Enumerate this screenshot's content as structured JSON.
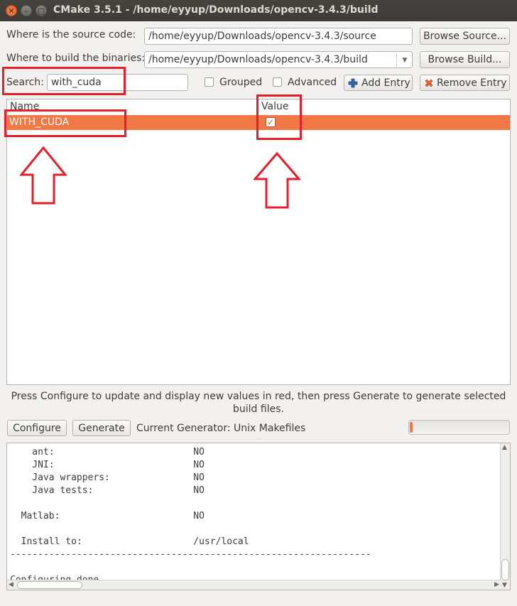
{
  "window": {
    "title": "CMake 3.5.1 - /home/eyyup/Downloads/opencv-3.4.3/build",
    "close_glyph": "✕",
    "min_glyph": "–",
    "max_glyph": "□"
  },
  "source": {
    "label": "Where is the source code:",
    "value": "/home/eyyup/Downloads/opencv-3.4.3/source",
    "browse_label": "Browse Source..."
  },
  "build": {
    "label": "Where to build the binaries:",
    "value": "/home/eyyup/Downloads/opencv-3.4.3/build",
    "browse_label": "Browse Build..."
  },
  "search": {
    "label": "Search:",
    "value": "with_cuda",
    "grouped_label": "Grouped",
    "grouped_checked": false,
    "advanced_label": "Advanced",
    "advanced_checked": false,
    "add_entry_label": "Add Entry",
    "remove_entry_label": "Remove Entry"
  },
  "table": {
    "columns": [
      "Name",
      "Value"
    ],
    "rows": [
      {
        "name": "WITH_CUDA",
        "value_checked": true,
        "check_glyph": "✓"
      }
    ]
  },
  "description": "Press Configure to update and display new values in red, then press Generate to generate selected build files.",
  "actions": {
    "configure_label": "Configure",
    "generate_label": "Generate",
    "generator_text": "Current Generator: Unix Makefiles",
    "progress": 0.02
  },
  "output": {
    "text": "    ant:                         NO\n    JNI:                         NO\n    Java wrappers:               NO\n    Java tests:                  NO\n\n  Matlab:                        NO\n\n  Install to:                    /usr/local\n-----------------------------------------------------------------\n\nConfiguring done"
  },
  "colors": {
    "selection": "#f07746",
    "annotation": "#e3202a"
  }
}
